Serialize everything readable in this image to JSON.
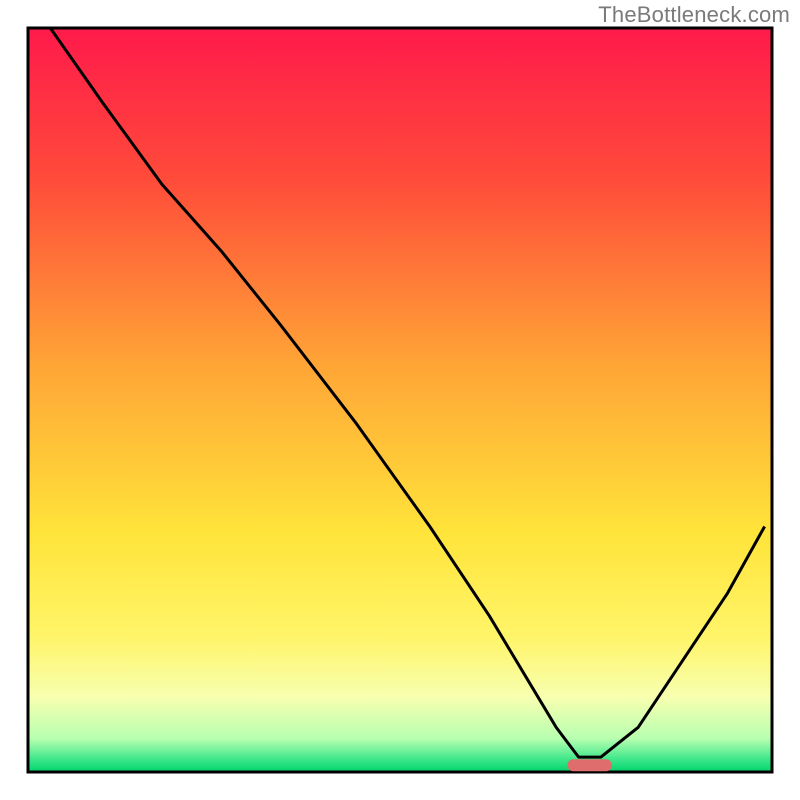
{
  "watermark": "TheBottleneck.com",
  "chart_data": {
    "type": "line",
    "title": "",
    "xlabel": "",
    "ylabel": "",
    "xlim": [
      0,
      100
    ],
    "ylim": [
      0,
      100
    ],
    "axes_visible": false,
    "grid": false,
    "gradient_background": {
      "stops": [
        {
          "pos": 0.0,
          "color": "#ff1a4b"
        },
        {
          "pos": 0.2,
          "color": "#ff4a3a"
        },
        {
          "pos": 0.45,
          "color": "#ffa436"
        },
        {
          "pos": 0.68,
          "color": "#ffe43a"
        },
        {
          "pos": 0.82,
          "color": "#fff56a"
        },
        {
          "pos": 0.9,
          "color": "#f7ffb0"
        },
        {
          "pos": 0.955,
          "color": "#b8ffb0"
        },
        {
          "pos": 0.985,
          "color": "#35e587"
        },
        {
          "pos": 1.0,
          "color": "#00d46a"
        }
      ]
    },
    "series": [
      {
        "name": "bottleneck-curve",
        "color": "#000000",
        "x": [
          3,
          10,
          18,
          22,
          26,
          34,
          44,
          54,
          62,
          68,
          71,
          74,
          77,
          82,
          88,
          94,
          99
        ],
        "values": [
          100,
          90,
          79,
          74.5,
          70,
          60,
          47,
          33,
          21,
          11,
          6,
          2,
          2,
          6,
          15,
          24,
          33
        ]
      }
    ],
    "marker": {
      "name": "optimal-range",
      "color": "#e06d6d",
      "x_start": 72.5,
      "x_end": 78.5,
      "y": 0.9
    }
  }
}
